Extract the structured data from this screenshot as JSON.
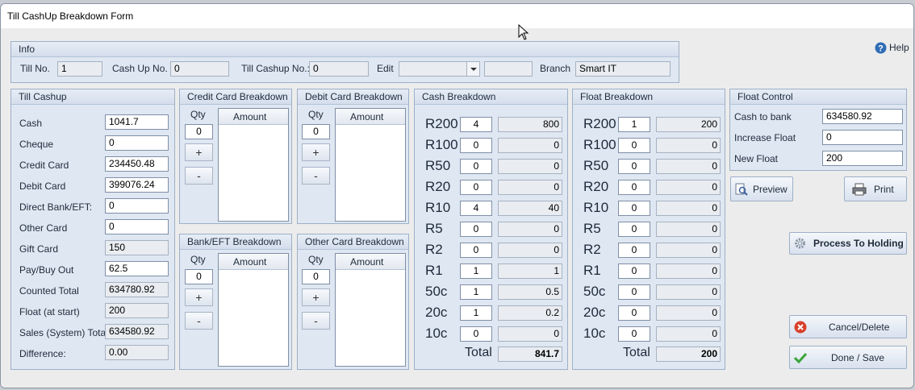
{
  "window": {
    "title": "Till CashUp Breakdown Form"
  },
  "help": {
    "label": "Help"
  },
  "info": {
    "title": "Info",
    "till_no_label": "Till No.",
    "till_no": "1",
    "cash_up_no_label": "Cash Up No.",
    "cash_up_no": "0",
    "till_cashup_no_label": "Till Cashup No.:",
    "till_cashup_no": "0",
    "edit_label": "Edit",
    "edit_value": "",
    "edit_extra": "",
    "branch_label": "Branch",
    "branch": "Smart IT"
  },
  "till_cashup": {
    "title": "Till Cashup",
    "rows": [
      {
        "label": "Cash",
        "value": "1041.7"
      },
      {
        "label": "Cheque",
        "value": "0"
      },
      {
        "label": "Credit Card",
        "value": "234450.48"
      },
      {
        "label": "Debit Card",
        "value": "399076.24"
      },
      {
        "label": "Direct Bank/EFT:",
        "value": "0"
      },
      {
        "label": "Other Card",
        "value": "0"
      },
      {
        "label": "Gift Card",
        "value": "150"
      },
      {
        "label": "Pay/Buy Out",
        "value": "62.5"
      },
      {
        "label": "Counted Total",
        "value": "634780.92"
      },
      {
        "label": "Float (at start)",
        "value": "200"
      },
      {
        "label": "Sales (System) Total",
        "value": "634580.92"
      },
      {
        "label": "Difference:",
        "value": "0.00"
      }
    ]
  },
  "card_panels": {
    "credit": {
      "title": "Credit Card Breakdown",
      "qty_label": "Qty",
      "qty": "0",
      "amount_label": "Amount",
      "plus": "+",
      "minus": "-"
    },
    "debit": {
      "title": "Debit Card Breakdown",
      "qty_label": "Qty",
      "qty": "0",
      "amount_label": "Amount",
      "plus": "+",
      "minus": "-"
    },
    "bank": {
      "title": "Bank/EFT Breakdown",
      "qty_label": "Qty",
      "qty": "0",
      "amount_label": "Amount",
      "plus": "+",
      "minus": "-"
    },
    "other": {
      "title": "Other Card Breakdown",
      "qty_label": "Qty",
      "qty": "0",
      "amount_label": "Amount",
      "plus": "+",
      "minus": "-"
    }
  },
  "cash_breakdown": {
    "title": "Cash Breakdown",
    "rows": [
      {
        "denom": "R200",
        "qty": "4",
        "amount": "800"
      },
      {
        "denom": "R100",
        "qty": "0",
        "amount": "0"
      },
      {
        "denom": "R50",
        "qty": "0",
        "amount": "0"
      },
      {
        "denom": "R20",
        "qty": "0",
        "amount": "0"
      },
      {
        "denom": "R10",
        "qty": "4",
        "amount": "40"
      },
      {
        "denom": "R5",
        "qty": "0",
        "amount": "0"
      },
      {
        "denom": "R2",
        "qty": "0",
        "amount": "0"
      },
      {
        "denom": "R1",
        "qty": "1",
        "amount": "1"
      },
      {
        "denom": "50c",
        "qty": "1",
        "amount": "0.5"
      },
      {
        "denom": "20c",
        "qty": "1",
        "amount": "0.2"
      },
      {
        "denom": "10c",
        "qty": "0",
        "amount": "0"
      }
    ],
    "total_label": "Total",
    "total": "841.7"
  },
  "float_breakdown": {
    "title": "Float Breakdown",
    "rows": [
      {
        "denom": "R200",
        "qty": "1",
        "amount": "200"
      },
      {
        "denom": "R100",
        "qty": "0",
        "amount": "0"
      },
      {
        "denom": "R50",
        "qty": "0",
        "amount": "0"
      },
      {
        "denom": "R20",
        "qty": "0",
        "amount": "0"
      },
      {
        "denom": "R10",
        "qty": "0",
        "amount": "0"
      },
      {
        "denom": "R5",
        "qty": "0",
        "amount": "0"
      },
      {
        "denom": "R2",
        "qty": "0",
        "amount": "0"
      },
      {
        "denom": "R1",
        "qty": "0",
        "amount": "0"
      },
      {
        "denom": "50c",
        "qty": "0",
        "amount": "0"
      },
      {
        "denom": "20c",
        "qty": "0",
        "amount": "0"
      },
      {
        "denom": "10c",
        "qty": "0",
        "amount": "0"
      }
    ],
    "total_label": "Total",
    "total": "200"
  },
  "float_control": {
    "title": "Float Control",
    "cash_to_bank_label": "Cash to bank",
    "cash_to_bank": "634580.92",
    "increase_float_label": "Increase Float",
    "increase_float": "0",
    "new_float_label": "New Float",
    "new_float": "200"
  },
  "buttons": {
    "preview": "Preview",
    "print": "Print",
    "process_to_holding": "Process To Holding",
    "cancel_delete": "Cancel/Delete",
    "done_save": "Done / Save"
  },
  "colors": {
    "panel_bg": "#dfe7f2",
    "panel_border": "#9db0c8",
    "cancel_red": "#d9402b",
    "done_green": "#3aa53a",
    "help_blue": "#2f6db5"
  }
}
